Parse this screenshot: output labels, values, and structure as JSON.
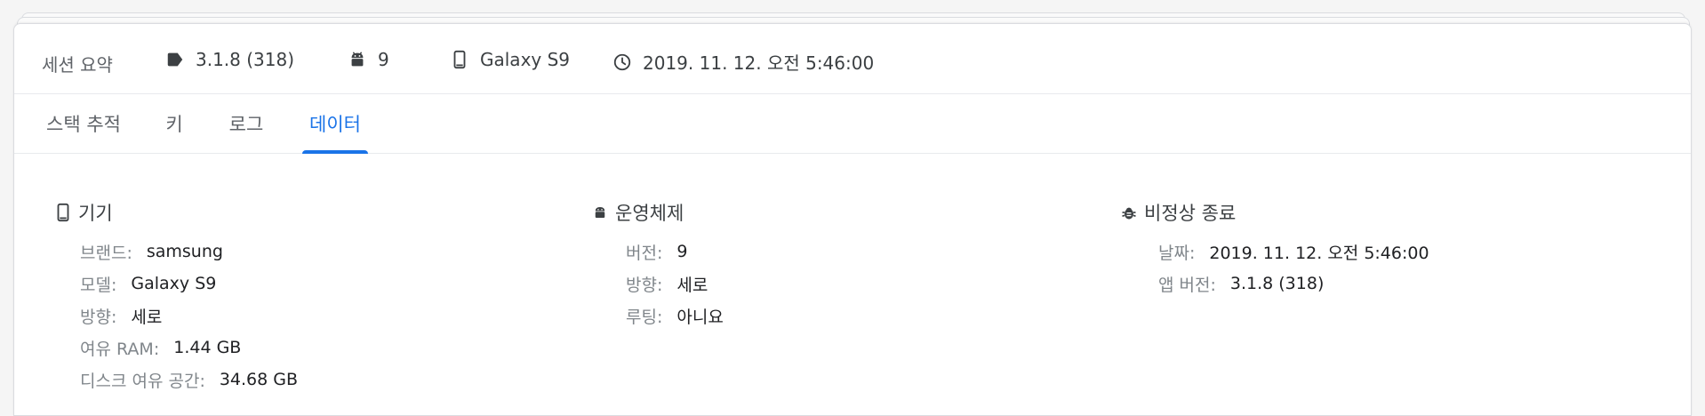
{
  "summary": {
    "title": "세션 요약",
    "version": "3.1.8 (318)",
    "os_version": "9",
    "device": "Galaxy S9",
    "timestamp": "2019. 11. 12. 오전 5:46:00"
  },
  "tabs": [
    {
      "label": "스택 추적",
      "active": false
    },
    {
      "label": "키",
      "active": false
    },
    {
      "label": "로그",
      "active": false
    },
    {
      "label": "데이터",
      "active": true
    }
  ],
  "colors": {
    "accent": "#1a73e8",
    "label": "#80868b",
    "value": "#202124"
  },
  "sections": {
    "device": {
      "title": "기기",
      "icon": "phone-icon",
      "rows": [
        {
          "key": "브랜드:",
          "value": "samsung"
        },
        {
          "key": "모델:",
          "value": "Galaxy S9"
        },
        {
          "key": "방향:",
          "value": "세로"
        },
        {
          "key": "여유 RAM:",
          "value": "1.44 GB"
        },
        {
          "key": "디스크 여유 공간:",
          "value": "34.68 GB"
        }
      ]
    },
    "os": {
      "title": "운영체제",
      "icon": "android-icon",
      "rows": [
        {
          "key": "버전:",
          "value": "9"
        },
        {
          "key": "방향:",
          "value": "세로"
        },
        {
          "key": "루팅:",
          "value": "아니요"
        }
      ]
    },
    "crash": {
      "title": "비정상 종료",
      "icon": "bug-icon",
      "rows": [
        {
          "key": "날짜:",
          "value": "2019. 11. 12. 오전 5:46:00"
        },
        {
          "key": "앱 버전:",
          "value": "3.1.8 (318)"
        }
      ]
    }
  }
}
